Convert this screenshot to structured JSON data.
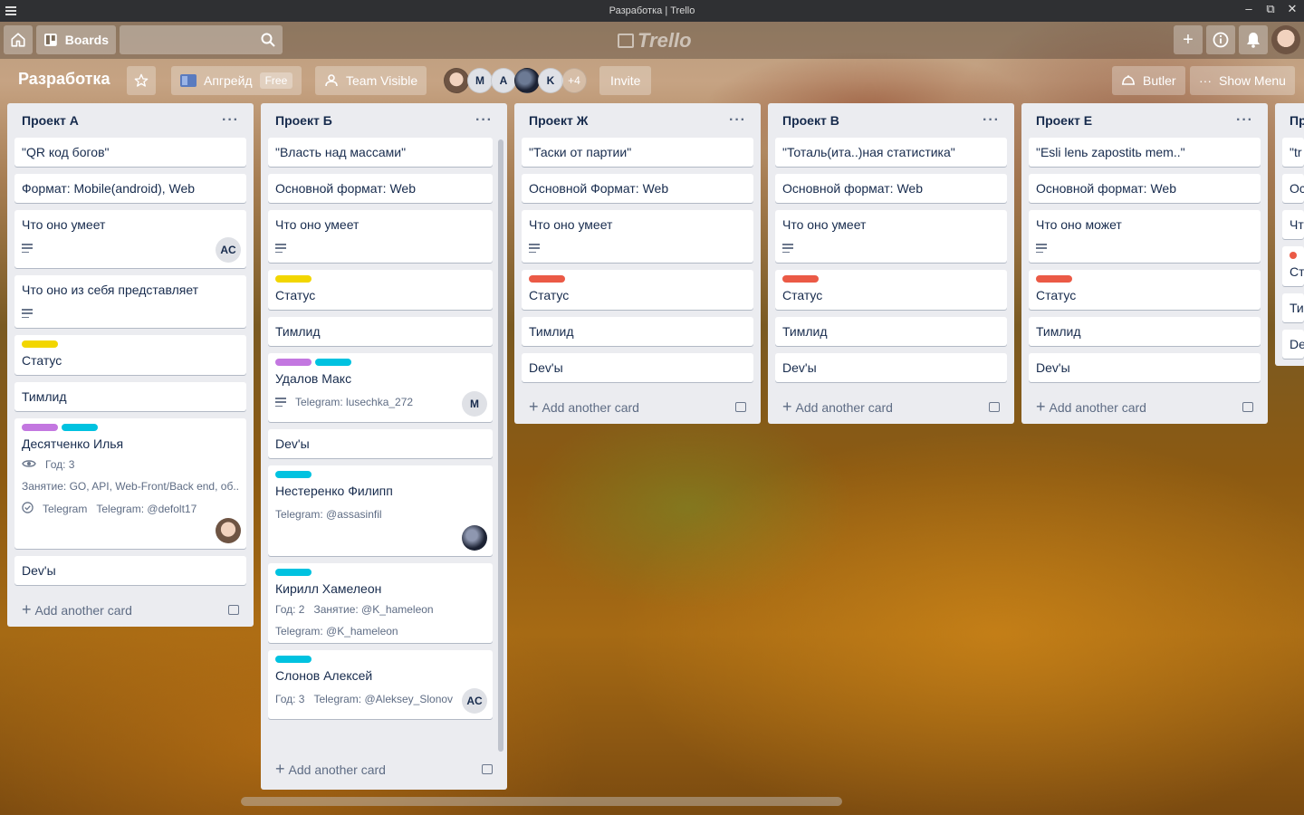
{
  "window": {
    "title": "Разработка | Trello",
    "controls": [
      "–",
      "⧉",
      "✕"
    ]
  },
  "header": {
    "boards_label": "Boards",
    "search_placeholder": "",
    "logo": "Trello"
  },
  "board": {
    "title": "Разработка",
    "upgrade_label": "Апгрейд",
    "free_badge": "Free",
    "visibility_label": "Team Visible",
    "members": [
      {
        "initials": "",
        "style": "photo1"
      },
      {
        "initials": "M",
        "style": "plain"
      },
      {
        "initials": "A",
        "style": "plain"
      },
      {
        "initials": "",
        "style": "photo2"
      },
      {
        "initials": "K",
        "style": "plain"
      }
    ],
    "more_members": "+4",
    "invite_label": "Invite",
    "butler_label": "Butler",
    "show_menu_label": "Show Menu"
  },
  "colors": {
    "yellow": "#f2d600",
    "purple": "#c377e0",
    "sky": "#00c2e0",
    "red": "#eb5a46"
  },
  "lists": [
    {
      "title": "Проект А",
      "cards": [
        {
          "title": "\"QR код богов\""
        },
        {
          "title": "Формат: Mobile(android), Web"
        },
        {
          "title": "Что оно умеет",
          "desc": true,
          "member": "AC"
        },
        {
          "title": "Что оно из себя представляет",
          "desc": true
        },
        {
          "title": "Статус",
          "labels": [
            "yellow"
          ]
        },
        {
          "title": "Тимлид"
        },
        {
          "title": "Десятченко Илья",
          "labels": [
            "purple",
            "sky"
          ],
          "watch": true,
          "texts": [
            "Год: 3",
            "Занятие: GO, API, Web-Front/Back end, об...",
            "Telegram",
            "Telegram: @defolt17"
          ],
          "photo": "photo1"
        },
        {
          "title": "Dev'ы"
        }
      ],
      "footer": "Add another card"
    },
    {
      "title": "Проект Б",
      "cards": [
        {
          "title": "\"Власть над массами\""
        },
        {
          "title": "Основной формат: Web"
        },
        {
          "title": "Что оно умеет",
          "desc": true
        },
        {
          "title": "Статус",
          "labels": [
            "yellow"
          ]
        },
        {
          "title": "Тимлид"
        },
        {
          "title": "Удалов Макс",
          "labels": [
            "purple",
            "sky"
          ],
          "desc": true,
          "texts": [
            "Telegram: lusechka_272"
          ],
          "member": "M"
        },
        {
          "title": "Dev'ы"
        },
        {
          "title": "Нестеренко Филипп",
          "labels": [
            "sky"
          ],
          "texts": [
            "Telegram: @assasinfil"
          ],
          "photo": "photo2"
        },
        {
          "title": "Кирилл Хамелеон",
          "labels": [
            "sky"
          ],
          "texts": [
            "Год: 2",
            "Занятие: @K_hameleon",
            "Telegram: @K_hameleon"
          ]
        },
        {
          "title": "Слонов Алексей",
          "labels": [
            "sky"
          ],
          "texts": [
            "Год: 3",
            "Telegram: @Aleksey_Slonov"
          ],
          "member": "AC"
        }
      ],
      "footer": "Add another card"
    },
    {
      "title": "Проект Ж",
      "cards": [
        {
          "title": "\"Таски от партии\""
        },
        {
          "title": "Основной Формат: Web"
        },
        {
          "title": "Что оно умеет",
          "desc": true
        },
        {
          "title": "Статус",
          "labels": [
            "red"
          ]
        },
        {
          "title": "Тимлид"
        },
        {
          "title": "Dev'ы"
        }
      ],
      "footer": "Add another card"
    },
    {
      "title": "Проект В",
      "cards": [
        {
          "title": "\"Тоталь(ита..)ная статистика\""
        },
        {
          "title": "Основной формат: Web"
        },
        {
          "title": "Что оно умеет",
          "desc": true
        },
        {
          "title": "Статус",
          "labels": [
            "red"
          ]
        },
        {
          "title": "Тимлид"
        },
        {
          "title": "Dev'ы"
        }
      ],
      "footer": "Add another card"
    },
    {
      "title": "Проект  Е",
      "cards": [
        {
          "title": "\"Esli lenь zapostitь mem..\""
        },
        {
          "title": "Основной формат: Web"
        },
        {
          "title": "Что оно может",
          "desc": true
        },
        {
          "title": "Статус",
          "labels": [
            "red"
          ]
        },
        {
          "title": "Тимлид"
        },
        {
          "title": "Dev'ы"
        }
      ],
      "footer": "Add another card"
    },
    {
      "title": "Пр",
      "cards": [
        {
          "title": "\"tr"
        },
        {
          "title": "Ос"
        },
        {
          "title": "Чт"
        },
        {
          "title": "Ст",
          "labels": [
            "red"
          ]
        },
        {
          "title": "Ти"
        },
        {
          "title": "De"
        }
      ],
      "footer": ""
    }
  ]
}
